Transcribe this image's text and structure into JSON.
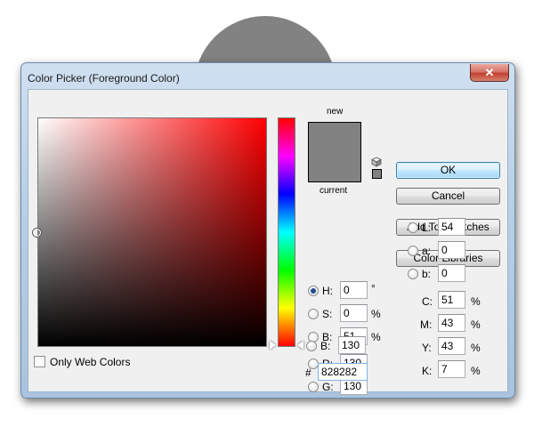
{
  "dialog": {
    "title": "Color Picker (Foreground Color)",
    "close_glyph": "✕"
  },
  "colors": {
    "selected": "#828282",
    "hue_start": "#ff0000"
  },
  "preview": {
    "new_label": "new",
    "current_label": "current",
    "gamut_icon": "cube-icon"
  },
  "buttons": {
    "ok": "OK",
    "cancel": "Cancel",
    "add_to_swatches": "Add To Swatches",
    "color_libraries": "Color Libraries"
  },
  "hsb": {
    "h": {
      "label": "H:",
      "value": "0",
      "unit": "°",
      "checked": true
    },
    "s": {
      "label": "S:",
      "value": "0",
      "unit": "%",
      "checked": false
    },
    "b": {
      "label": "B:",
      "value": "51",
      "unit": "%",
      "checked": false
    }
  },
  "lab": {
    "l": {
      "label": "L:",
      "value": "54"
    },
    "a": {
      "label": "a:",
      "value": "0"
    },
    "b": {
      "label": "b:",
      "value": "0"
    }
  },
  "rgb": {
    "r": {
      "label": "R:",
      "value": "130"
    },
    "g": {
      "label": "G:",
      "value": "130"
    },
    "b": {
      "label": "B:",
      "value": "130"
    }
  },
  "cmyk": {
    "c": {
      "label": "C:",
      "value": "51",
      "unit": "%"
    },
    "m": {
      "label": "M:",
      "value": "43",
      "unit": "%"
    },
    "y": {
      "label": "Y:",
      "value": "43",
      "unit": "%"
    },
    "k": {
      "label": "K:",
      "value": "7",
      "unit": "%"
    }
  },
  "hex": {
    "label": "#",
    "value": "828282"
  },
  "only_web_colors": {
    "label": "Only Web Colors",
    "checked": false
  }
}
